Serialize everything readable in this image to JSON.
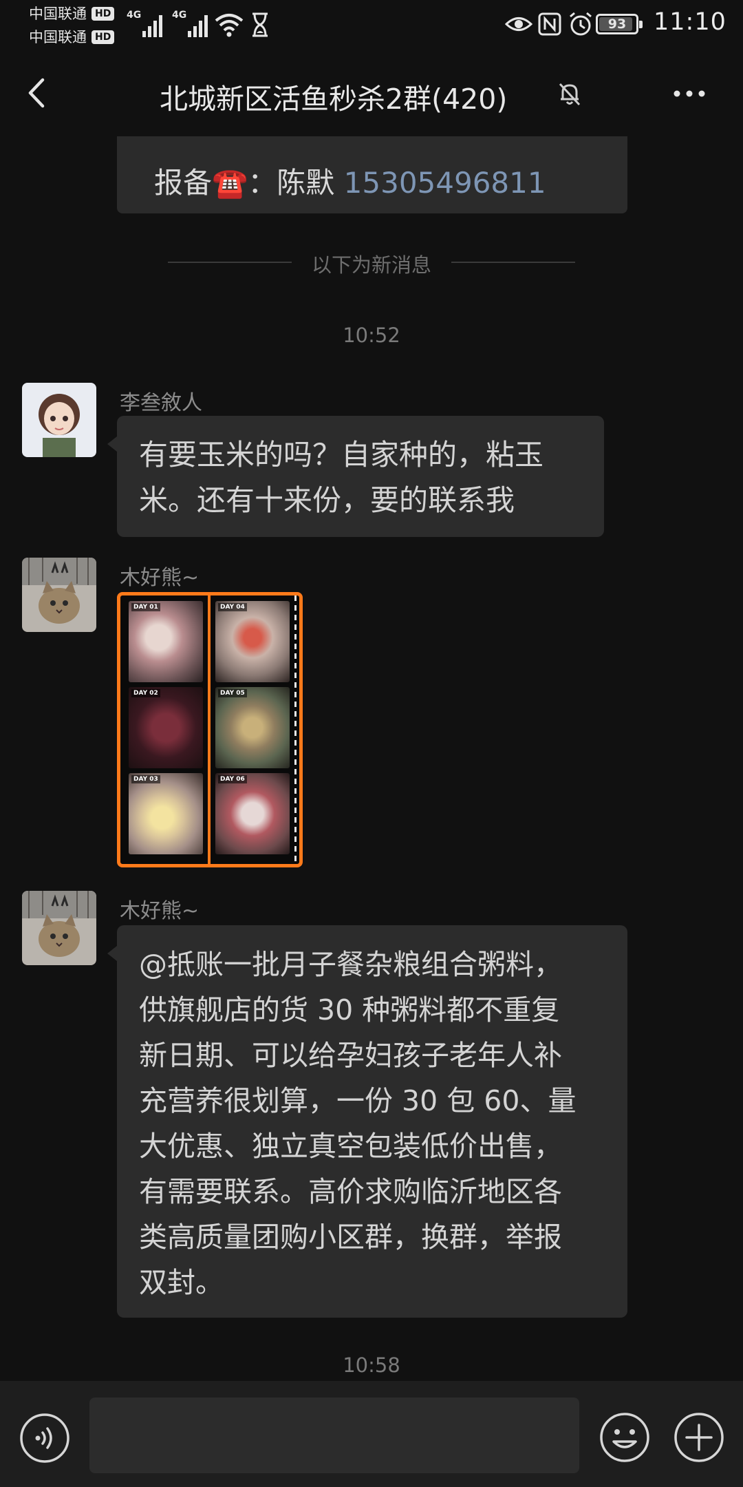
{
  "status_bar": {
    "carrier_1": "中国联通",
    "carrier_2": "中国联通",
    "hd_badge": "HD",
    "network_1": "4G",
    "network_2": "4G",
    "battery": "93",
    "battery_level": 0.93,
    "time": "11:10",
    "icons": [
      "wifi-icon",
      "hourglass-icon",
      "eye-icon",
      "nfc-icon",
      "alarm-icon"
    ]
  },
  "header": {
    "title": "北城新区活鱼秒杀2群(420)",
    "icons": [
      "back-arrow-icon",
      "muted-bell-icon",
      "more-dots-icon"
    ]
  },
  "notice": {
    "prefix": "报备☎️：陈默 ",
    "phone": "15305496811"
  },
  "divider": {
    "label": "以下为新消息"
  },
  "messages": [
    {
      "time": "10:52",
      "sender": "李叁敘人",
      "lines": [
        "有要玉米的吗？自家种的，粘玉",
        "米。还有十来份，要的联系我"
      ]
    },
    {
      "sender": "木好熊~",
      "image_tags": [
        "DAY 01",
        "DAY 02",
        "DAY 03",
        "DAY 04",
        "DAY 05",
        "DAY 06"
      ]
    },
    {
      "sender": "木好熊~",
      "lines": [
        "@抵账一批月子餐杂粮组合粥料，",
        "供旗舰店的货 30 种粥料都不重复",
        "新日期、可以给孕妇孩子老年人补",
        "充营养很划算，一份 30 包 60、量",
        "大优惠、独立真空包装低价出售，",
        "有需要联系。高价求购临沂地区各",
        "类高质量团购小区群，换群，举报",
        "双封。"
      ]
    },
    {
      "time": "10:58"
    }
  ],
  "input_bar": {
    "placeholder": "",
    "icons": [
      "voice-icon",
      "emoji-icon",
      "plus-icon"
    ]
  },
  "colors": {
    "background": "#111111",
    "bubble": "#2c2c2c",
    "phone_link": "#7e96b5",
    "image_border": "#ff7a1a"
  }
}
